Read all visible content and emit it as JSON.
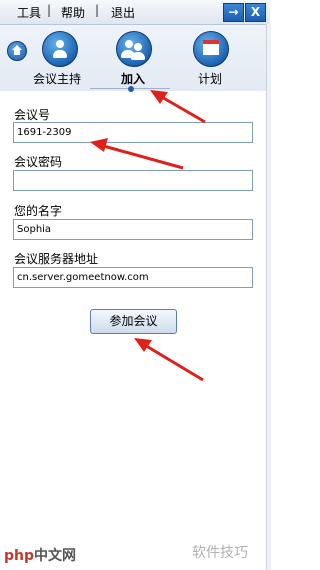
{
  "menu": {
    "tools": "工具",
    "help": "帮助",
    "exit": "退出",
    "separator": "|"
  },
  "window_buttons": {
    "pin_glyph": "→",
    "close_glyph": "X"
  },
  "tabs": [
    {
      "label": "会议主持",
      "icon": "host-person-icon"
    },
    {
      "label": "加入",
      "icon": "join-people-icon",
      "active": true
    },
    {
      "label": "计划",
      "icon": "calendar-icon"
    }
  ],
  "form": {
    "meeting_id_label": "会议号",
    "meeting_id_value": "1691-2309",
    "password_label": "会议密码",
    "password_value": "",
    "name_label": "您的名字",
    "name_value": "Sophia",
    "server_label": "会议服务器地址",
    "server_value": "cn.server.gomeetnow.com"
  },
  "join_button": "参加会议",
  "watermark": {
    "left": "php中文网",
    "left_prefix": "php",
    "left_suffix": "中文网",
    "right": "软件技巧"
  },
  "colors": {
    "accent": "#1f5fa8",
    "arrow": "#e0201a"
  }
}
